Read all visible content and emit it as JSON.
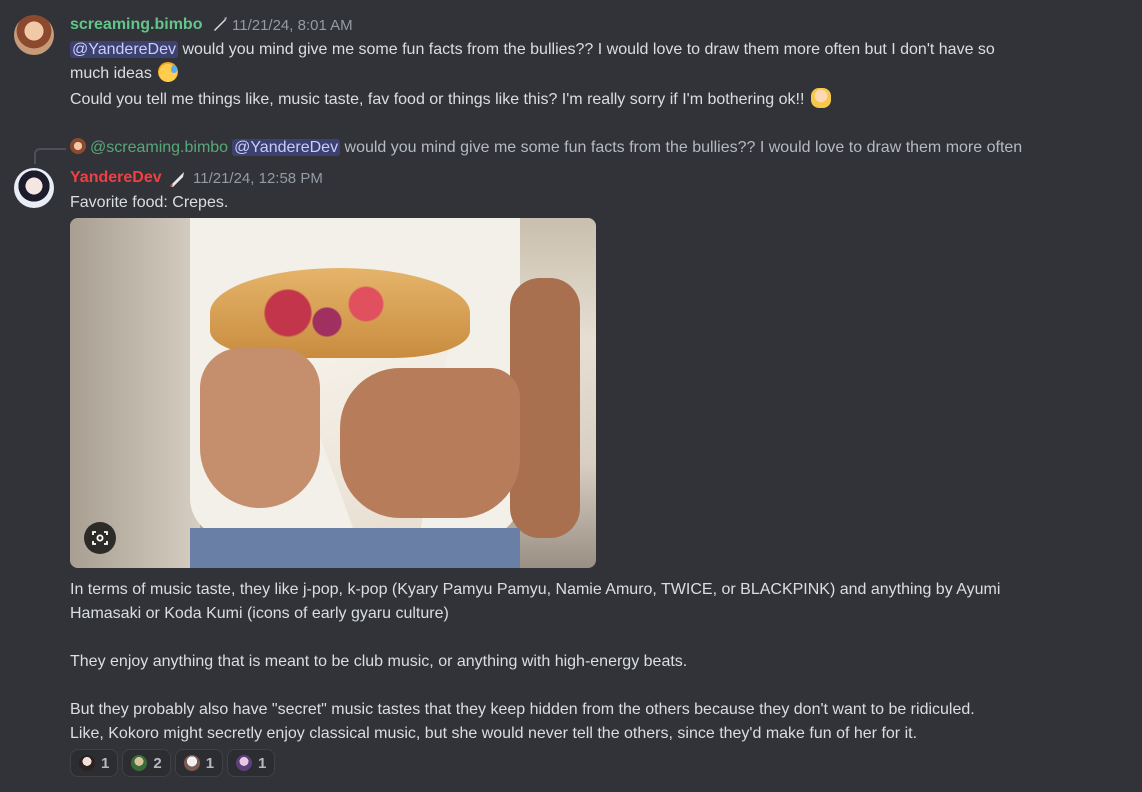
{
  "message1": {
    "username": "screaming.bimbo",
    "role_icon": "quill-icon",
    "timestamp": "11/21/24, 8:01 AM",
    "mention": "@YandereDev",
    "line1_rest": " would you mind give me some fun facts from the bullies?? I would love to draw them more often but I don't have so",
    "line2": "much ideas",
    "line3": "Could you tell me things like, music taste, fav food or things like this? I'm really sorry if I'm bothering ok!!"
  },
  "reply_preview": {
    "username": "@screaming.bimbo",
    "mention": "@YandereDev",
    "text": " would you mind give me some fun facts from the bullies?? I would love to draw them more often"
  },
  "message2": {
    "username": "YandereDev",
    "role_icon": "knife-icon",
    "timestamp": "11/21/24, 12:58 PM",
    "line_food": "Favorite food: Crepes.",
    "music_line1": "In terms of music taste, they like j-pop, k-pop (Kyary Pamyu Pamyu, Namie Amuro, TWICE, or BLACKPINK) and anything by Ayumi",
    "music_line2": "Hamasaki or Koda Kumi (icons of early gyaru culture)",
    "club_line": "They enjoy anything that is meant to be club music, or anything with high-energy beats.",
    "secret_line1": "But they probably also have \"secret\" music tastes that they keep hidden from the others because they don't want to be ridiculed.",
    "secret_line2": "Like, Kokoro might secretly enjoy classical music, but she would never tell the others, since they'd make fun of her for it."
  },
  "reactions": [
    {
      "emoji": "character-emoji-1",
      "count": "1"
    },
    {
      "emoji": "character-emoji-2",
      "count": "2"
    },
    {
      "emoji": "character-emoji-3",
      "count": "1"
    },
    {
      "emoji": "character-emoji-4",
      "count": "1"
    }
  ],
  "colors": {
    "background": "#313338",
    "username1": "#62c58a",
    "username2": "#f23f43",
    "mention_bg": "#4b4f8f",
    "text": "#dbdee1",
    "muted": "#949ba4"
  }
}
